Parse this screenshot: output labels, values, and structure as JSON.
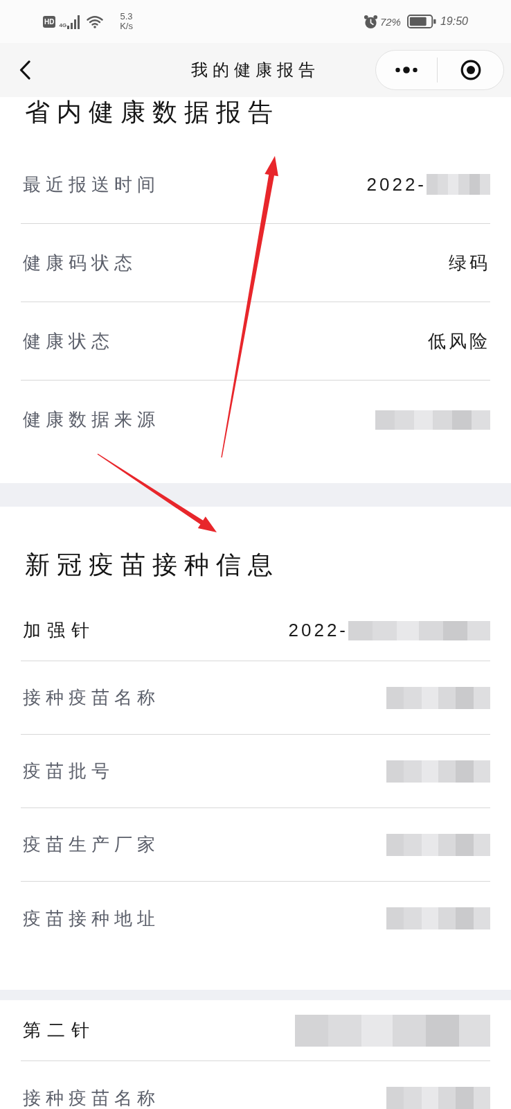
{
  "status_bar": {
    "hd_badge": "HD",
    "network": "4G",
    "speed": "5.3",
    "speed_unit": "K/s",
    "battery": "72%",
    "time": "19:50"
  },
  "nav": {
    "title": "我的健康报告"
  },
  "health_report": {
    "title": "省内健康数据报告",
    "rows": [
      {
        "label": "最近报送时间",
        "value": "2022-",
        "redacted": true
      },
      {
        "label": "健康码状态",
        "value": "绿码",
        "redacted": false
      },
      {
        "label": "健康状态",
        "value": "低风险",
        "redacted": false
      },
      {
        "label": "健康数据来源",
        "redacted": true
      }
    ]
  },
  "vaccination": {
    "title": "新冠疫苗接种信息",
    "doses": [
      {
        "name": "加强针",
        "date": "2022-",
        "date_redacted": true,
        "fields": [
          {
            "label": "接种疫苗名称",
            "redacted": true
          },
          {
            "label": "疫苗批号",
            "redacted": true
          },
          {
            "label": "疫苗生产厂家",
            "redacted": true
          },
          {
            "label": "疫苗接种地址",
            "redacted": true
          }
        ]
      },
      {
        "name": "第二针",
        "date_redacted": true,
        "fields": [
          {
            "label": "接种疫苗名称",
            "redacted": true
          }
        ]
      }
    ]
  }
}
